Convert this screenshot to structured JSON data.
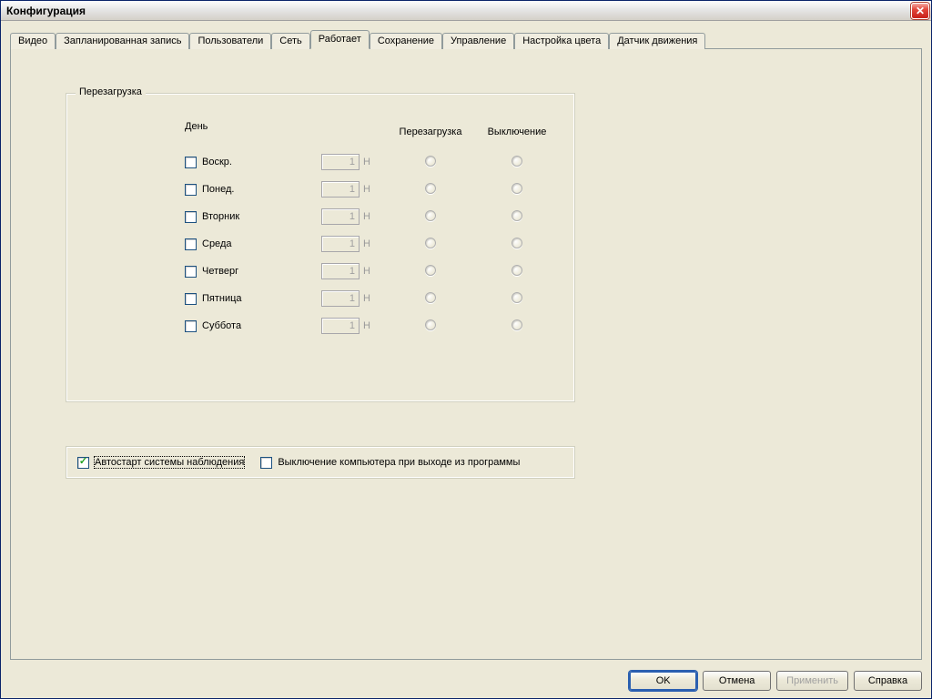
{
  "window": {
    "title": "Конфигурация"
  },
  "tabs": [
    {
      "label": "Видео"
    },
    {
      "label": "Запланированная запись"
    },
    {
      "label": "Пользователи"
    },
    {
      "label": "Сеть"
    },
    {
      "label": "Работает",
      "active": true
    },
    {
      "label": "Сохранение"
    },
    {
      "label": "Управление"
    },
    {
      "label": "Настройка цвета"
    },
    {
      "label": "Датчик движения"
    }
  ],
  "reboot": {
    "legend": "Перезагрузка",
    "headers": {
      "day": "День",
      "reboot": "Перезагрузка",
      "shutdown": "Выключение"
    },
    "hour_suffix": "H",
    "days": [
      {
        "checked": false,
        "label": "Воскр.",
        "hour": "1"
      },
      {
        "checked": false,
        "label": "Понед.",
        "hour": "1"
      },
      {
        "checked": false,
        "label": "Вторник",
        "hour": "1"
      },
      {
        "checked": false,
        "label": "Среда",
        "hour": "1"
      },
      {
        "checked": false,
        "label": "Четверг",
        "hour": "1"
      },
      {
        "checked": false,
        "label": "Пятница",
        "hour": "1"
      },
      {
        "checked": false,
        "label": "Суббота",
        "hour": "1"
      }
    ]
  },
  "options": {
    "autostart": {
      "checked": true,
      "label": "Автостарт системы наблюдения"
    },
    "shutdown_on_exit": {
      "checked": false,
      "label": "Выключение компьютера при выходе из программы"
    }
  },
  "buttons": {
    "ok": "OK",
    "cancel": "Отмена",
    "apply": "Применить",
    "help": "Справка"
  }
}
